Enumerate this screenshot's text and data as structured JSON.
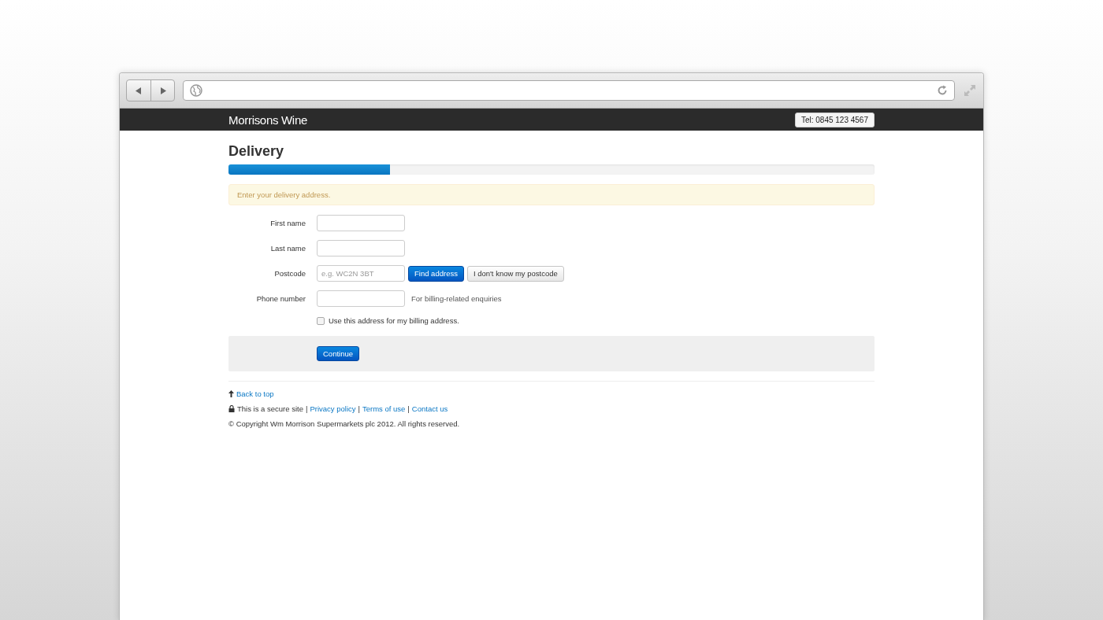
{
  "navbar": {
    "brand": "Morrisons Wine",
    "phone": "Tel: 0845 123 4567"
  },
  "page": {
    "title": "Delivery",
    "progress": {
      "level": 0.25
    },
    "alert": "Enter your delivery address."
  },
  "form": {
    "fields": [
      {
        "kind": "text",
        "label": "First name"
      },
      {
        "kind": "text",
        "label": "Last name"
      },
      {
        "kind": "postcode",
        "label": "Postcode",
        "placeholder": "e.g. WC2N 3BT",
        "primary_button": "Find address",
        "secondary_button": "I don't know my postcode"
      },
      {
        "kind": "help",
        "label": "Phone number",
        "help": "For billing-related enquiries"
      }
    ],
    "checkbox": {
      "label": "Use this address for my billing address.",
      "checked": false
    },
    "submit": "Continue"
  },
  "footer": {
    "back_to_top": "Back to top",
    "line": [
      {
        "kind": "text",
        "text": "This is a secure site"
      },
      {
        "kind": "separator",
        "text": "|"
      },
      {
        "kind": "link",
        "text": "Privacy policy"
      },
      {
        "kind": "separator",
        "text": "|"
      },
      {
        "kind": "link",
        "text": "Terms of use"
      },
      {
        "kind": "separator",
        "text": "|"
      },
      {
        "kind": "link",
        "text": "Contact us"
      }
    ],
    "copyright": "© Copyright Wm Morrison Supermarkets plc 2012. All rights reserved."
  }
}
